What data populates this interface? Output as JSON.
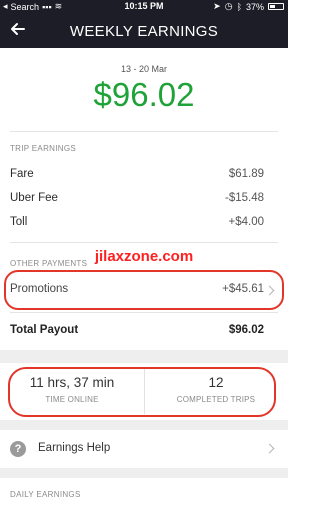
{
  "status_bar": {
    "carrier": "Search",
    "time": "10:15 PM",
    "battery": "37%"
  },
  "nav": {
    "title": "WEEKLY EARNINGS"
  },
  "summary": {
    "date_range": "13 - 20 Mar",
    "amount": "$96.02",
    "amount_color": "#1fa238"
  },
  "trip_earnings": {
    "header": "TRIP EARNINGS",
    "rows": [
      {
        "label": "Fare",
        "value": "$61.89"
      },
      {
        "label": "Uber Fee",
        "value": "-$15.48"
      },
      {
        "label": "Toll",
        "value": "+$4.00"
      }
    ]
  },
  "other_payments": {
    "header": "OTHER PAYMENTS",
    "promotions_label": "Promotions",
    "promotions_value": "+$45.61"
  },
  "watermark": "jilaxzone.com",
  "total": {
    "label": "Total Payout",
    "value": "$96.02"
  },
  "stats": {
    "time_online_value": "11 hrs, 37 min",
    "time_online_label": "TIME ONLINE",
    "trips_value": "12",
    "trips_label": "COMPLETED TRIPS"
  },
  "help": {
    "label": "Earnings Help",
    "icon": "question-icon"
  },
  "daily": {
    "header": "DAILY EARNINGS"
  },
  "colors": {
    "header_bg": "#1d1d27",
    "accent_green": "#1fa238",
    "annotation_red": "#e3362a"
  }
}
